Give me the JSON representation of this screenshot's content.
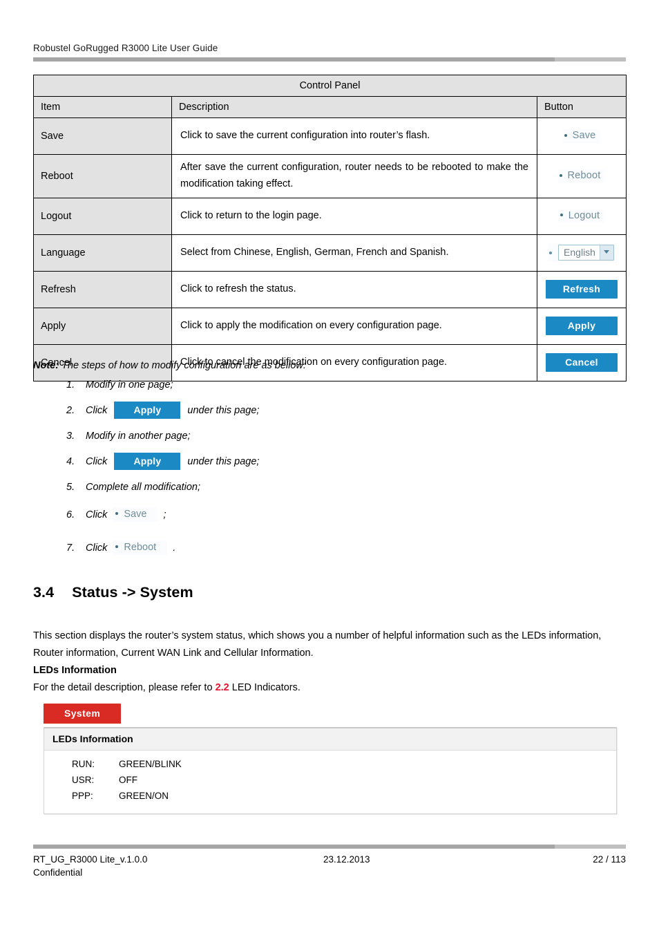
{
  "header": {
    "title": "Robustel GoRugged R3000 Lite User Guide"
  },
  "control_panel": {
    "title": "Control Panel",
    "columns": [
      "Item",
      "Description",
      "Button"
    ],
    "rows": [
      {
        "item": "Save",
        "description": "Click to save the current configuration into router’s flash.",
        "button_type": "link",
        "button_label": "Save"
      },
      {
        "item": "Reboot",
        "description": "After save the current configuration, router needs to be rebooted to make the modification taking effect.",
        "button_type": "link",
        "button_label": "Reboot"
      },
      {
        "item": "Logout",
        "description": "Click to return to the login page.",
        "button_type": "link",
        "button_label": "Logout"
      },
      {
        "item": "Language",
        "description": "Select from Chinese, English, German, French and Spanish.",
        "button_type": "select",
        "button_label": "English",
        "options": [
          "Chinese",
          "English",
          "German",
          "French",
          "Spanish"
        ]
      },
      {
        "item": "Refresh",
        "description": "Click to refresh the status.",
        "button_type": "button",
        "button_label": "Refresh"
      },
      {
        "item": "Apply",
        "description": "Click to apply the modification on every configuration page.",
        "button_type": "button",
        "button_label": "Apply"
      },
      {
        "item": "Cancel",
        "description": "Click to cancel the modification on every configuration page.",
        "button_type": "button",
        "button_label": "Cancel"
      }
    ]
  },
  "note": {
    "label": "Note:",
    "lead": "The steps of how to modify configuration are as bellow:",
    "steps": [
      {
        "num": "1.",
        "text": "Modify in one page;",
        "kind": "plain"
      },
      {
        "num": "2.",
        "prefix": "Click",
        "widget": "Apply",
        "widget_kind": "blue-button",
        "suffix": "under this page;",
        "kind": "widget"
      },
      {
        "num": "3.",
        "text": "Modify in another page;",
        "kind": "plain"
      },
      {
        "num": "4.",
        "prefix": "Click",
        "widget": "Apply",
        "widget_kind": "blue-button",
        "suffix": "under this page;",
        "kind": "widget"
      },
      {
        "num": "5.",
        "text": "Complete all modification;",
        "kind": "plain"
      },
      {
        "num": "6.",
        "prefix": "Click",
        "widget": "Save",
        "widget_kind": "link",
        "suffix": ";",
        "kind": "widget"
      },
      {
        "num": "7.",
        "prefix": "Click",
        "widget": "Reboot",
        "widget_kind": "link",
        "suffix": ".",
        "kind": "widget"
      }
    ]
  },
  "section": {
    "number": "3.4",
    "title": "Status -> System",
    "paragraph": "This section displays the router’s system status, which shows you a number of helpful information such as the LEDs information, Router information, Current WAN Link and Cellular Information.",
    "subhead": "LEDs Information",
    "ref_prefix": "For the detail description, please refer to ",
    "ref_link": "2.2",
    "ref_suffix": " LED Indicators."
  },
  "ui_shot": {
    "tab_label": "System",
    "panel_title": "LEDs Information",
    "leds": [
      {
        "key": "RUN:",
        "value": "GREEN/BLINK"
      },
      {
        "key": "USR:",
        "value": "OFF"
      },
      {
        "key": "PPP:",
        "value": "GREEN/ON"
      }
    ]
  },
  "footer": {
    "doc_id": "RT_UG_R3000 Lite_v.1.0.0",
    "date": "23.12.2013",
    "page": "22 / 113",
    "classification": "Confidential"
  },
  "colors": {
    "accent_blue": "#1a89c4",
    "accent_red": "#da2a24",
    "xref_red": "#e8112d",
    "link_text": "#6e8c9b",
    "table_header_bg": "#e2e2e2"
  }
}
